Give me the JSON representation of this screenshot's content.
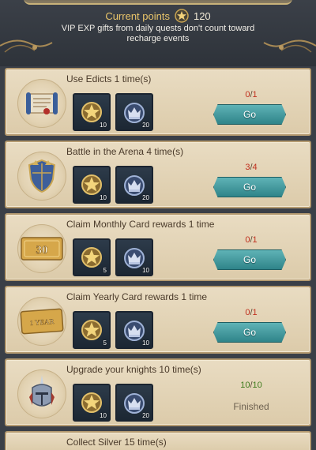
{
  "header": {
    "points_label": "Current points",
    "points_value": "120",
    "notice": "VIP EXP gifts from daily quests don't count toward recharge events"
  },
  "quests": [
    {
      "title": "Use Edicts 1 time(s)",
      "emblem": "scroll-icon",
      "rewards": [
        {
          "icon": "star-medal-icon",
          "count": "10"
        },
        {
          "icon": "crown-badge-icon",
          "count": "20"
        }
      ],
      "progress_current": "0",
      "progress_total": "1",
      "status": "incomplete",
      "button_label": "Go"
    },
    {
      "title": "Battle in the Arena 4 time(s)",
      "emblem": "shield-icon",
      "rewards": [
        {
          "icon": "star-medal-icon",
          "count": "10"
        },
        {
          "icon": "crown-badge-icon",
          "count": "20"
        }
      ],
      "progress_current": "3",
      "progress_total": "4",
      "status": "incomplete",
      "button_label": "Go"
    },
    {
      "title": "Claim Monthly Card rewards 1 time",
      "emblem": "monthly-card-icon",
      "emblem_text": "30",
      "rewards": [
        {
          "icon": "star-medal-icon",
          "count": "5"
        },
        {
          "icon": "crown-badge-icon",
          "count": "10"
        }
      ],
      "progress_current": "0",
      "progress_total": "1",
      "status": "incomplete",
      "button_label": "Go"
    },
    {
      "title": "Claim Yearly Card rewards 1 time",
      "emblem": "yearly-card-icon",
      "emblem_text": "1 YEAR",
      "rewards": [
        {
          "icon": "star-medal-icon",
          "count": "5"
        },
        {
          "icon": "crown-badge-icon",
          "count": "10"
        }
      ],
      "progress_current": "0",
      "progress_total": "1",
      "status": "incomplete",
      "button_label": "Go"
    },
    {
      "title": "Upgrade your knights 10 time(s)",
      "emblem": "knight-helmet-icon",
      "rewards": [
        {
          "icon": "star-medal-icon",
          "count": "10"
        },
        {
          "icon": "crown-badge-icon",
          "count": "20"
        }
      ],
      "progress_current": "10",
      "progress_total": "10",
      "status": "complete",
      "status_label": "Finished"
    },
    {
      "title": "Collect Silver 15 time(s)"
    }
  ],
  "colors": {
    "accent_gold": "#e9c56a",
    "button_teal": "#3f9ca0",
    "progress_red": "#c0301e",
    "progress_green": "#3d7a1c",
    "card_bg": "#e4d5b8"
  }
}
